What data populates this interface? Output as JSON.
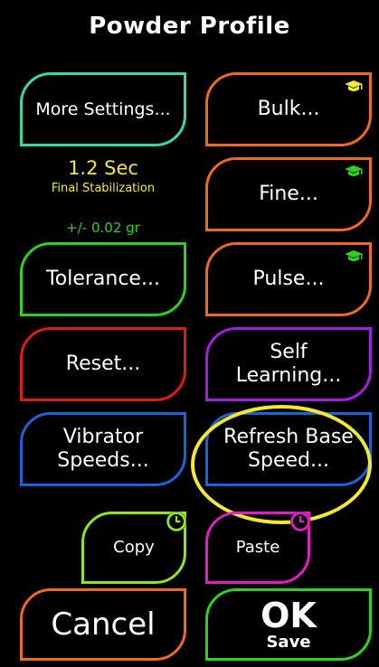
{
  "title": "Powder Profile",
  "info": {
    "stab_value": "1.2 Sec",
    "stab_label": "Final Stabilization",
    "tolerance_value": "+/- 0.02 gr"
  },
  "buttons": {
    "more_settings": "More Settings...",
    "bulk": "Bulk...",
    "fine": "Fine...",
    "tolerance": "Tolerance...",
    "pulse": "Pulse...",
    "reset": "Reset...",
    "self_learning_l1": "Self",
    "self_learning_l2": "Learning...",
    "vibrator_l1": "Vibrator",
    "vibrator_l2": "Speeds...",
    "refresh_l1": "Refresh Base",
    "refresh_l2": "Speed...",
    "copy": "Copy",
    "paste": "Paste",
    "cancel": "Cancel",
    "ok": "OK",
    "save": "Save"
  },
  "colors": {
    "teal": "#35d9a8",
    "orange": "#ef6a1a",
    "green": "#2ed11f",
    "red": "#e0191a",
    "purple": "#a21ee0",
    "blue": "#1a63d8",
    "lime": "#8ee61c",
    "magenta": "#e61cc6",
    "yellow": "#f2ea2e",
    "stab_text": "#f2ea2e",
    "tol_text": "#2ed11f"
  },
  "icons": {
    "grad_cap": "graduation-cap-icon",
    "clock": "clock-icon"
  }
}
